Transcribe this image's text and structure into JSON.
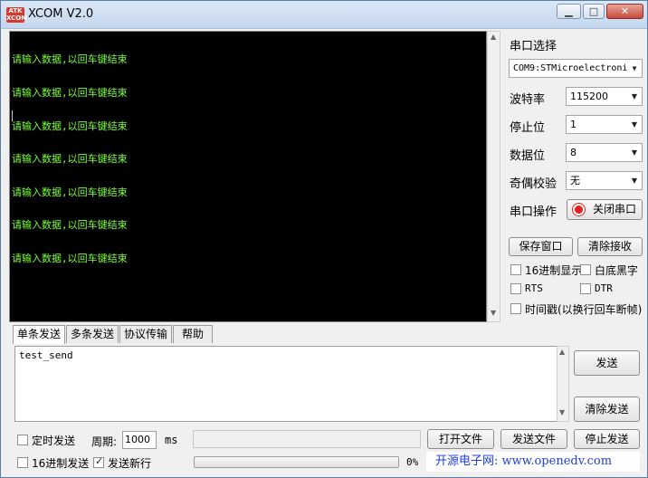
{
  "window": {
    "logo_text": "ATK XCOM",
    "title": "XCOM V2.0",
    "controls": {
      "minimize": "▁",
      "maximize": "□",
      "close": "✕"
    }
  },
  "receive": {
    "lines": [
      "请输入数据,以回车键结束",
      "请输入数据,以回车键结束",
      "请输入数据,以回车键结束",
      "请输入数据,以回车键结束",
      "请输入数据,以回车键结束",
      "请输入数据,以回车键结束",
      "请输入数据,以回车键结束"
    ],
    "text_color": "#7dff3a"
  },
  "settings": {
    "port_label": "串口选择",
    "port_value": "COM9:STMicroelectroni",
    "baud_label": "波特率",
    "baud_value": "115200",
    "stopbits_label": "停止位",
    "stopbits_value": "1",
    "databits_label": "数据位",
    "databits_value": "8",
    "parity_label": "奇偶校验",
    "parity_value": "无",
    "operation_label": "串口操作",
    "toggle_port_button": "关闭串口"
  },
  "receive_controls": {
    "save_window": "保存窗口",
    "clear_receive": "清除接收",
    "hex_display": "16进制显示",
    "white_bg": "白底黑字",
    "rts": "RTS",
    "dtr": "DTR",
    "timestamp": "时间戳(以换行回车断帧)"
  },
  "tabs": [
    "单条发送",
    "多条发送",
    "协议传输",
    "帮助"
  ],
  "send": {
    "text": "test_send",
    "send_button": "发送",
    "clear_send_button": "清除发送"
  },
  "bottom": {
    "timed_send": "定时发送",
    "period_label": "周期:",
    "period_value": "1000",
    "period_unit": "ms",
    "hex_send": "16进制发送",
    "send_newline": "发送新行",
    "send_newline_checked": true,
    "progress_value": "0%",
    "open_file": "打开文件",
    "send_file": "发送文件",
    "stop_send": "停止发送",
    "site": "开源电子网: www.openedv.com"
  }
}
